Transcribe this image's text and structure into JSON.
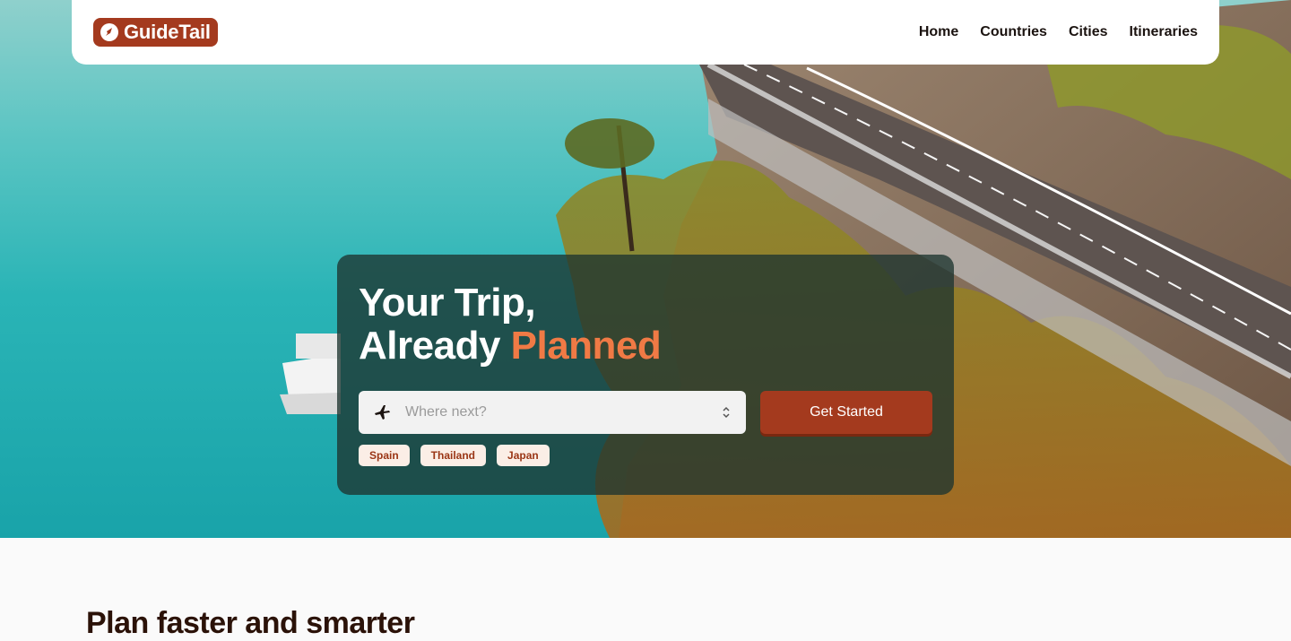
{
  "brand": {
    "name": "GuideTail",
    "color": "#a43a1e"
  },
  "nav": {
    "items": [
      {
        "label": "Home"
      },
      {
        "label": "Countries"
      },
      {
        "label": "Cities"
      },
      {
        "label": "Itineraries"
      }
    ]
  },
  "hero": {
    "headline_line1": "Your Trip,",
    "headline_line2_plain": "Already ",
    "headline_line2_accent": "Planned",
    "accent_color": "#f07a45",
    "search": {
      "placeholder": "Where next?",
      "value": "",
      "icon": "plane-icon"
    },
    "cta_label": "Get Started",
    "chips": [
      {
        "label": "Spain"
      },
      {
        "label": "Thailand"
      },
      {
        "label": "Japan"
      }
    ]
  },
  "section": {
    "heading": "Plan faster and smarter"
  }
}
